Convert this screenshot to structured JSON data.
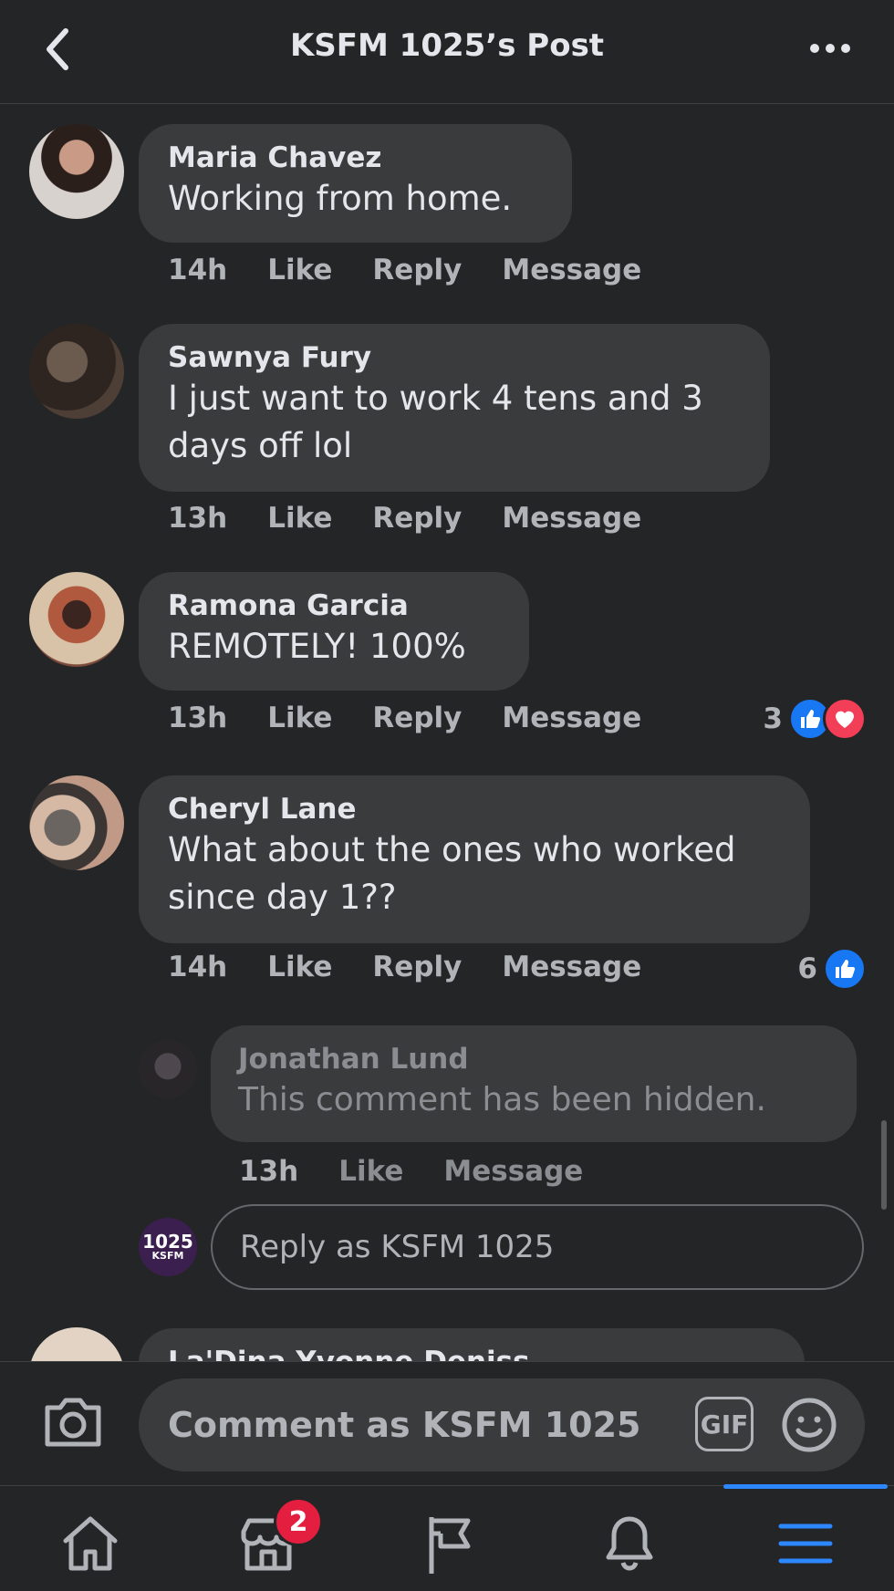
{
  "header": {
    "title": "KSFM 1025’s Post"
  },
  "comments": [
    {
      "name": "Maria Chavez",
      "text": "Working from home.",
      "time": "14h",
      "like": "Like",
      "reply": "Reply",
      "message": "Message"
    },
    {
      "name": "Sawnya Fury",
      "text": "I just want to work 4 tens and 3 days off lol",
      "time": "13h",
      "like": "Like",
      "reply": "Reply",
      "message": "Message"
    },
    {
      "name": "Ramona Garcia",
      "text": "REMOTELY! 100%",
      "time": "13h",
      "like": "Like",
      "reply": "Reply",
      "message": "Message",
      "reaction_count": "3"
    },
    {
      "name": "Cheryl Lane",
      "text": "What about the ones who worked since day 1??",
      "time": "14h",
      "like": "Like",
      "reply": "Reply",
      "message": "Message",
      "reaction_count": "6"
    }
  ],
  "hidden_reply": {
    "name": "Jonathan Lund",
    "text": "This comment has been hidden.",
    "time": "13h",
    "like": "Like",
    "message": "Message"
  },
  "reply_box": {
    "placeholder": "Reply as KSFM 1025",
    "avatar_text": "1025",
    "avatar_sub": "KSFM"
  },
  "partial_comment": {
    "name": "La'Dina Yvonne Deniss"
  },
  "composer": {
    "placeholder": "Comment as KSFM 1025",
    "gif_label": "GIF"
  },
  "tabbar": {
    "marketplace_badge": "2"
  },
  "colors": {
    "accent": "#2d88ff",
    "like": "#1877f2",
    "love": "#f33e58",
    "badge": "#e41e3f"
  }
}
